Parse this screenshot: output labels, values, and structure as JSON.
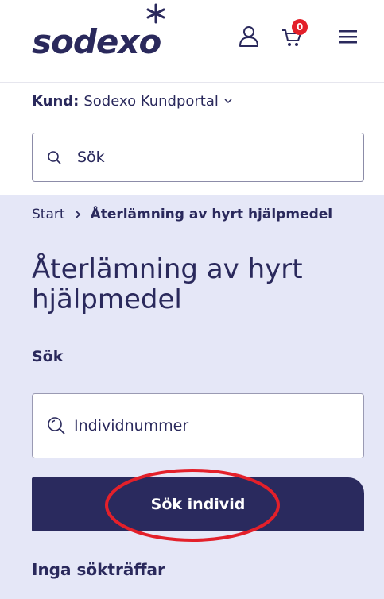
{
  "header": {
    "logo_text": "sodexo",
    "cart_count": "0",
    "icons": {
      "user": "user-icon",
      "cart": "cart-icon",
      "menu": "hamburger-menu-icon",
      "logo_star": "star-icon"
    }
  },
  "customer": {
    "label": "Kund:",
    "value": "Sodexo Kundportal"
  },
  "top_search": {
    "placeholder": "Sök"
  },
  "breadcrumb": {
    "start": "Start",
    "current": "Återlämning av hyrt hjälpmedel"
  },
  "page": {
    "title": "Återlämning av hyrt hjälpmedel",
    "search_heading": "Sök",
    "individ_placeholder": "Individnummer",
    "search_button": "Sök individ",
    "no_results": "Inga sökträffar"
  },
  "colors": {
    "brand_navy": "#2a295c",
    "badge_red": "#e3202a",
    "panel_bg": "#e5e7f7",
    "highlight": "#e3202a"
  }
}
